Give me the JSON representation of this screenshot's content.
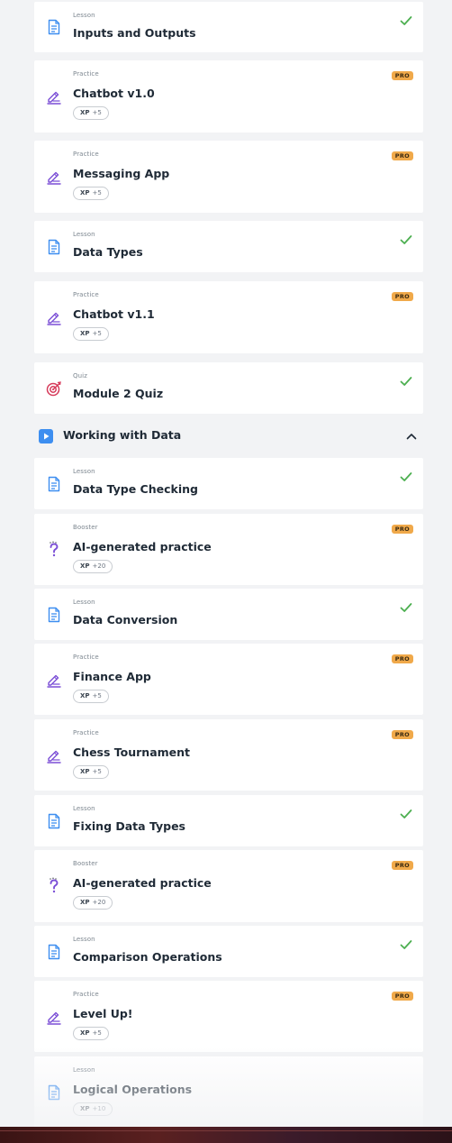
{
  "items_top": [
    {
      "kind": "Lesson",
      "title": "Inputs and Outputs",
      "status": "done",
      "icon": "lesson-icon"
    },
    {
      "kind": "Practice",
      "title": "Chatbot v1.0",
      "status": "pro",
      "xp_label": "XP",
      "xp_value": "+5",
      "icon": "practice-icon"
    },
    {
      "kind": "Practice",
      "title": "Messaging App",
      "status": "pro",
      "xp_label": "XP",
      "xp_value": "+5",
      "icon": "practice-icon"
    },
    {
      "kind": "Lesson",
      "title": "Data Types",
      "status": "done",
      "icon": "lesson-icon"
    },
    {
      "kind": "Practice",
      "title": "Chatbot v1.1",
      "status": "pro",
      "xp_label": "XP",
      "xp_value": "+5",
      "icon": "practice-icon"
    },
    {
      "kind": "Quiz",
      "title": "Module 2 Quiz",
      "status": "done",
      "icon": "quiz-target-icon"
    }
  ],
  "section": {
    "title": "Working with Data",
    "icon": "play-icon",
    "expanded": true
  },
  "items_section": [
    {
      "kind": "Lesson",
      "title": "Data Type Checking",
      "status": "done",
      "icon": "lesson-icon"
    },
    {
      "kind": "Booster",
      "title": "AI-generated practice",
      "status": "pro",
      "xp_label": "XP",
      "xp_value": "+20",
      "icon": "booster-question-icon"
    },
    {
      "kind": "Lesson",
      "title": "Data Conversion",
      "status": "done",
      "icon": "lesson-icon"
    },
    {
      "kind": "Practice",
      "title": "Finance App",
      "status": "pro",
      "xp_label": "XP",
      "xp_value": "+5",
      "icon": "practice-icon"
    },
    {
      "kind": "Practice",
      "title": "Chess Tournament",
      "status": "pro",
      "xp_label": "XP",
      "xp_value": "+5",
      "icon": "practice-icon"
    },
    {
      "kind": "Lesson",
      "title": "Fixing Data Types",
      "status": "done",
      "icon": "lesson-icon"
    },
    {
      "kind": "Booster",
      "title": "AI-generated practice",
      "status": "pro",
      "xp_label": "XP",
      "xp_value": "+20",
      "icon": "booster-question-icon"
    },
    {
      "kind": "Lesson",
      "title": "Comparison Operations",
      "status": "done",
      "icon": "lesson-icon"
    },
    {
      "kind": "Practice",
      "title": "Level Up!",
      "status": "pro",
      "xp_label": "XP",
      "xp_value": "+5",
      "icon": "practice-icon"
    },
    {
      "kind": "Lesson",
      "title": "Logical Operations",
      "status": "none",
      "xp_label": "XP",
      "xp_value": "+10",
      "icon": "lesson-icon"
    }
  ],
  "pro_badge_label": "PRO",
  "colors": {
    "background": "#f2f3f5",
    "card": "#ffffff",
    "lesson_icon": "#3d8ef0",
    "practice_icon": "#7b4fd6",
    "quiz_icon": "#d63a5a",
    "booster_icon": "#7b4fd6",
    "check": "#4caf50",
    "pro_badge": "#f0a94a",
    "section_icon": "#3d8ef0"
  }
}
